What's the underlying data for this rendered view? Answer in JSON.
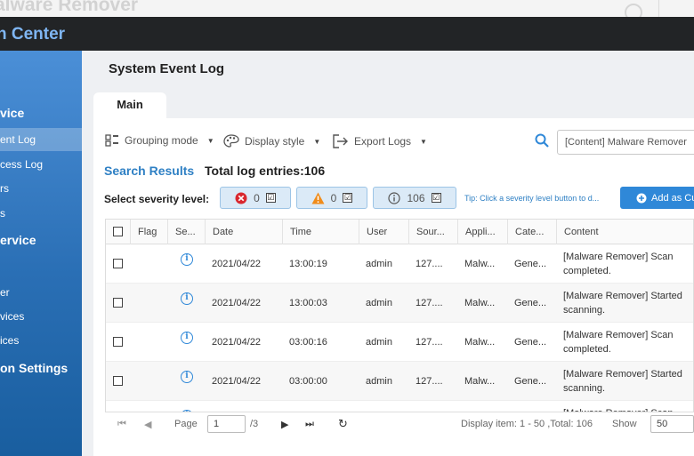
{
  "app": {
    "title_fragment": "alware Remover",
    "center_title_fragment": "n Center"
  },
  "sidebar": {
    "items": [
      {
        "label": "vice",
        "kind": "section"
      },
      {
        "label": "ent Log",
        "kind": "item",
        "active": true
      },
      {
        "label": "cess Log",
        "kind": "item"
      },
      {
        "label": "rs",
        "kind": "item"
      },
      {
        "label": "s",
        "kind": "item"
      },
      {
        "label": "ervice",
        "kind": "section"
      },
      {
        "label": "",
        "kind": "item"
      },
      {
        "label": "er",
        "kind": "item"
      },
      {
        "label": "vices",
        "kind": "item"
      },
      {
        "label": "ices",
        "kind": "item"
      },
      {
        "label": "on Settings",
        "kind": "section"
      }
    ]
  },
  "page": {
    "title": "System Event Log",
    "tab": "Main"
  },
  "toolbar": {
    "grouping_label": "Grouping mode",
    "display_label": "Display style",
    "export_label": "Export Logs",
    "search_value": "[Content] Malware Remover"
  },
  "results": {
    "label": "Search Results",
    "total": "Total log entries:106"
  },
  "severity": {
    "label": "Select severity level:",
    "error_count": "0",
    "warning_count": "0",
    "info_count": "106",
    "check": "☑",
    "tip": "Tip: Click a severity level button to d...",
    "add_label": "Add as Cu"
  },
  "table": {
    "headers": [
      "Flag",
      "Se...",
      "Date",
      "Time",
      "User",
      "Sour...",
      "Appli...",
      "Cate...",
      "Content"
    ],
    "rows": [
      {
        "date": "2021/04/22",
        "time": "13:00:19",
        "user": "admin",
        "source": "127....",
        "app": "Malw...",
        "category": "Gene...",
        "content": "[Malware Remover] Scan completed."
      },
      {
        "date": "2021/04/22",
        "time": "13:00:03",
        "user": "admin",
        "source": "127....",
        "app": "Malw...",
        "category": "Gene...",
        "content": "[Malware Remover] Started scanning."
      },
      {
        "date": "2021/04/22",
        "time": "03:00:16",
        "user": "admin",
        "source": "127....",
        "app": "Malw...",
        "category": "Gene...",
        "content": "[Malware Remover] Scan completed."
      },
      {
        "date": "2021/04/22",
        "time": "03:00:00",
        "user": "admin",
        "source": "127....",
        "app": "Malw...",
        "category": "Gene...",
        "content": "[Malware Remover] Started scanning."
      },
      {
        "date": "",
        "time": "",
        "user": "",
        "source": "",
        "app": "",
        "category": "",
        "content": "[Malware Remover] Scan"
      }
    ]
  },
  "pager": {
    "page_label": "Page",
    "page_value": "1",
    "total_pages": "/3",
    "display_info": "Display item: 1 - 50 ,Total: 106",
    "show_label": "Show",
    "show_value": "50"
  }
}
